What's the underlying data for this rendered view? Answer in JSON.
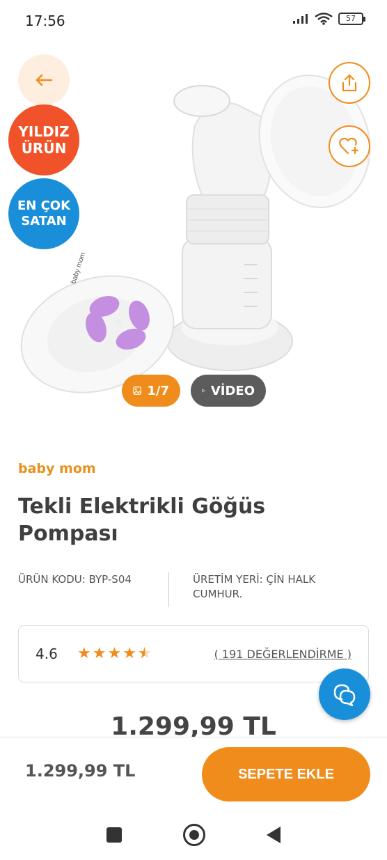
{
  "status_bar": {
    "time": "17:56",
    "battery": "57"
  },
  "product": {
    "gallery_counter": "1/7",
    "video_label": "VİDEO",
    "badges": {
      "star": [
        "YILDIZ",
        "ÜRÜN"
      ],
      "best_seller": [
        "EN ÇOK",
        "SATAN"
      ]
    },
    "brand": "baby mom",
    "title": "Tekli Elektrikli Göğüs Pompası",
    "code": "ÜRÜN KODU: BYP-S04",
    "origin": "ÜRETİM YERİ: ÇİN HALK CUMHUR.",
    "rating": {
      "value": "4.6",
      "stars": 4.5,
      "reviews": "( 191 DEĞERLENDİRME )"
    },
    "price_partial": "1.299,99 TL",
    "device_logo": "baby mom"
  },
  "bottom_bar": {
    "price": "1.299,99 TL",
    "add_to_cart": "SEPETE EKLE"
  },
  "colors": {
    "accent": "#f08c1c",
    "star_badge": "#f0532a",
    "best_badge": "#1a8fd9",
    "chat": "#1a8fd9"
  }
}
